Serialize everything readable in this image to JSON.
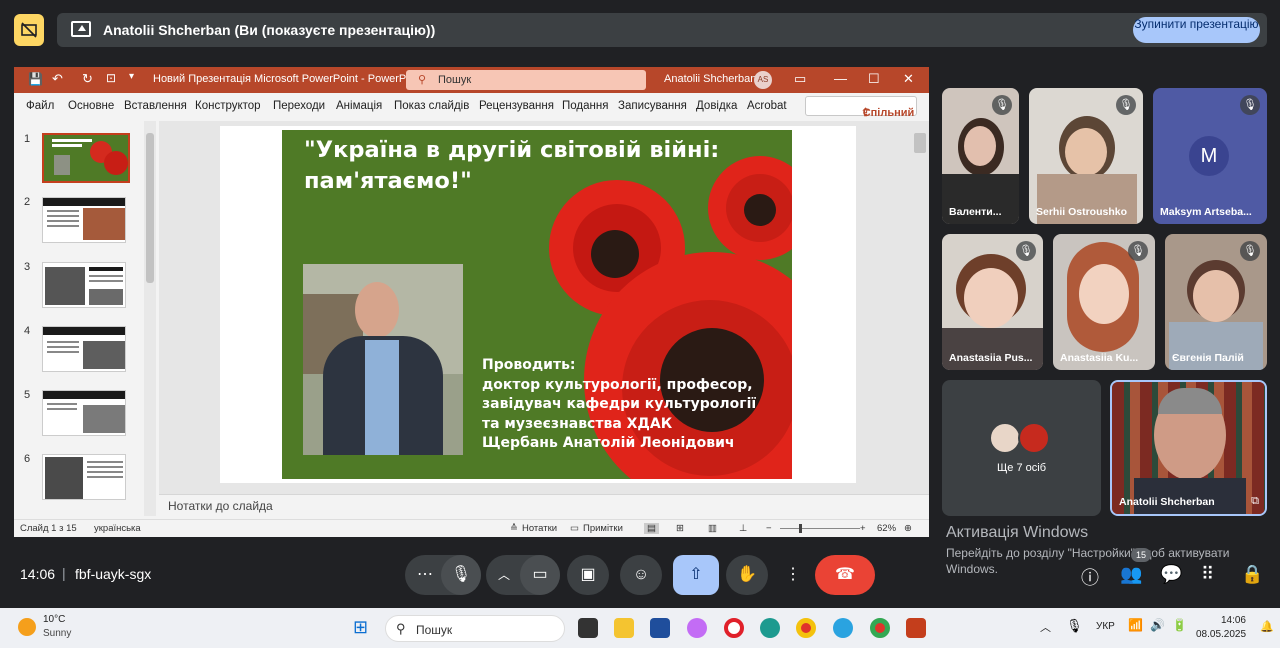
{
  "top": {
    "presenter_banner": "Anatolii Shcherban (Ви (показуєте презентацію))",
    "stop_button": "Зупинити презентацію"
  },
  "ppt": {
    "window_title": "Новий Презентація Microsoft PowerPoint  -  PowerPoint",
    "search_placeholder": "Пошук",
    "user_name": "Anatolii Shcherban",
    "user_initials": "AS",
    "ribbon_tabs": [
      "Файл",
      "Основне",
      "Вставлення",
      "Конструктор",
      "Переходи",
      "Анімація",
      "Показ слайдів",
      "Рецензування",
      "Подання",
      "Записування",
      "Довідка",
      "Acrobat"
    ],
    "share_button": "Спільний доступ",
    "slide_numbers": [
      "1",
      "2",
      "3",
      "4",
      "5",
      "6"
    ],
    "slide": {
      "title": "\"Україна в другій світовій війні: пам'ятаємо!\"",
      "text_lines": [
        "Проводить:",
        "доктор культурології, професор,",
        "завідувач кафедри культурології",
        "та музеєзнавства ХДАК",
        "Щербань Анатолій Леонідович"
      ]
    },
    "notes_label": "Нотатки до слайда",
    "status": {
      "slide_info": "Слайд 1 з 15",
      "language": "українська",
      "notes_btn": "Нотатки",
      "comments_btn": "Примітки",
      "zoom": "62%"
    }
  },
  "participants": [
    {
      "name": "Валенти..."
    },
    {
      "name": "Serhii Ostroushko"
    },
    {
      "name": "Maksym Artseba...",
      "initial": "M"
    },
    {
      "name": "Anastasiia Pus..."
    },
    {
      "name": "Anastasiia Ku..."
    },
    {
      "name": "Євгенія Палій"
    },
    {
      "name": "Ще 7 осіб"
    },
    {
      "name": "Anatolii Shcherban"
    }
  ],
  "activation": {
    "title": "Активація Windows",
    "desc": "Перейдіть до розділу \"Настройки\", щоб активувати Windows."
  },
  "meet": {
    "time": "14:06",
    "code": "fbf-uayk-sgx",
    "people_badge": "15"
  },
  "taskbar": {
    "weather_temp": "10°C",
    "weather_desc": "Sunny",
    "search": "Пошук",
    "lang": "УКР",
    "time": "14:06",
    "date": "08.05.2025"
  },
  "colors": {
    "ppt_accent": "#b7472a",
    "slide_green": "#4f7a26",
    "end_call": "#ea4335",
    "present_active": "#a8c7fa"
  }
}
